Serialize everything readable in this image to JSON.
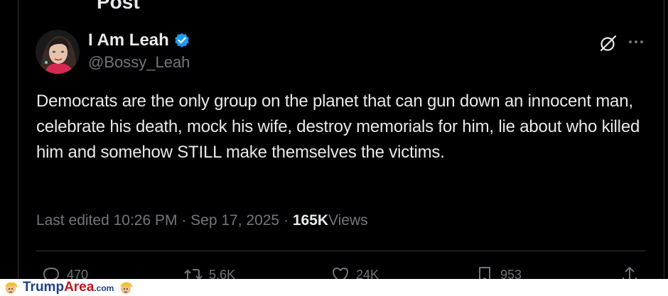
{
  "header": {
    "title": "Post"
  },
  "author": {
    "display_name": "I Am Leah",
    "handle": "@Bossy_Leah",
    "verified": true
  },
  "tweet": {
    "text": "Democrats are the only group on the planet that can gun down an innocent man, celebrate his death, mock his wife, destroy memorials for him, lie about who killed him and somehow STILL make themselves the victims."
  },
  "meta": {
    "edited_label": "Last edited",
    "time": "10:26 PM",
    "separator": "·",
    "date": "Sep 17, 2025",
    "views_count": "165K",
    "views_label": "Views"
  },
  "actions": {
    "replies": "470",
    "reposts": "5.6K",
    "likes": "24K",
    "bookmarks": "953"
  },
  "watermark": {
    "trump": "Trump",
    "area": "Area",
    "com": ".com"
  },
  "colors": {
    "background": "#000000",
    "text_primary": "#e7e9ea",
    "text_secondary": "#71767b",
    "verified_blue": "#1d9bf0",
    "divider": "#2f3336"
  },
  "icons": [
    "back-arrow-icon",
    "verified-badge-icon",
    "grok-icon",
    "more-icon",
    "reply-icon",
    "repost-icon",
    "like-icon",
    "bookmark-icon",
    "share-icon"
  ]
}
